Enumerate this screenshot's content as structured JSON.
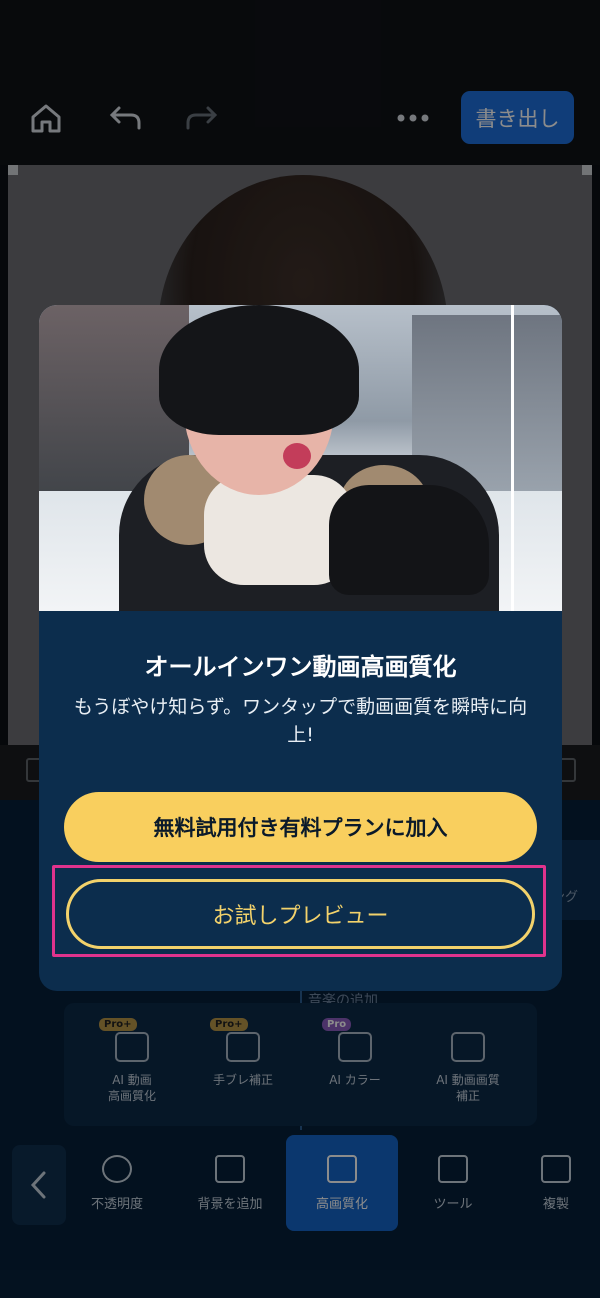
{
  "toolbar": {
    "home_icon": "home-icon",
    "undo_icon": "undo-icon",
    "redo_icon": "redo-icon",
    "more_icon": "more-horizontal-icon",
    "export_label": "書き出し"
  },
  "modal": {
    "title": "オールインワン動画高画質化",
    "description": "もうぼやけ知らず。ワンタップで動画画質を瞬時に向上!",
    "primary_button": "無料試用付き有料プランに加入",
    "secondary_button": "お試しプレビュー"
  },
  "timeline": {
    "right_clip_label": "ング",
    "audio_label": "音楽の追加"
  },
  "features": [
    {
      "badge": "Pro+",
      "label": "AI 動画\n高画質化"
    },
    {
      "badge": "Pro+",
      "label": "手ブレ補正"
    },
    {
      "badge": "Pro",
      "label": "AI カラー"
    },
    {
      "badge": "",
      "label": "AI 動画画質\n補正"
    }
  ],
  "tabs": [
    {
      "label": "不透明度"
    },
    {
      "label": "背景を追加"
    },
    {
      "label": "高画質化"
    },
    {
      "label": "ツール"
    },
    {
      "label": "複製"
    }
  ],
  "colors": {
    "accent_blue": "#1e6fdc",
    "cta_yellow": "#f9cf5e",
    "highlight_pink": "#e0338d",
    "modal_bg": "#0c2d4d"
  }
}
